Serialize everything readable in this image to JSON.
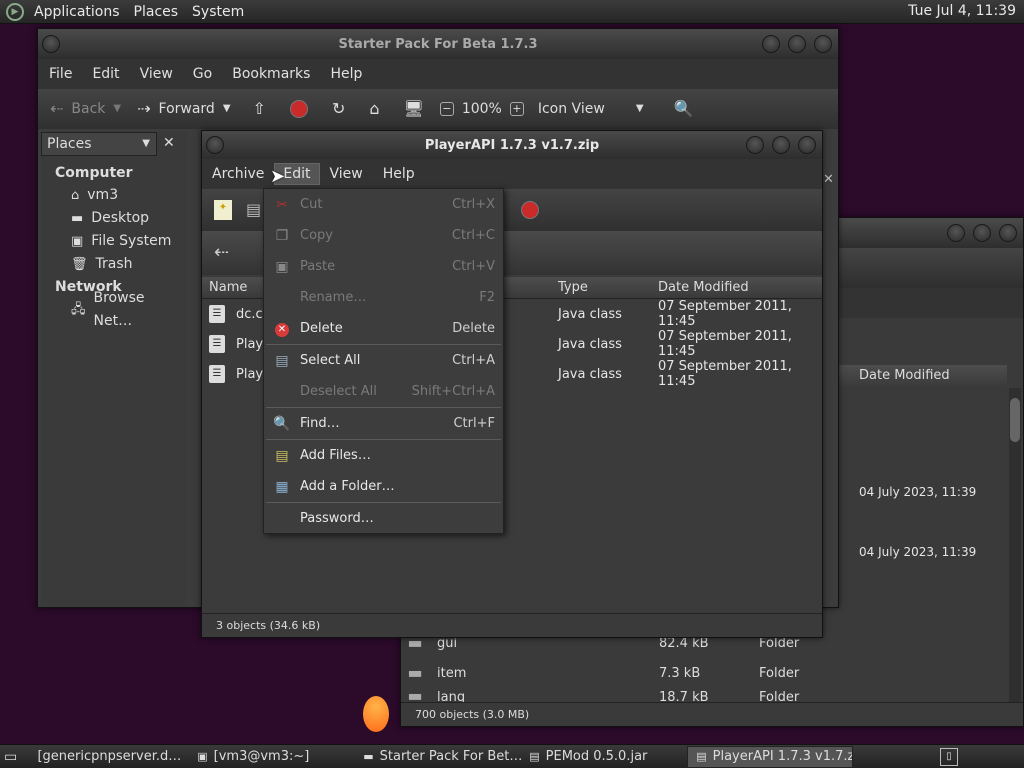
{
  "topbar": {
    "applications": "Applications",
    "places": "Places",
    "system": "System",
    "clock": "Tue Jul  4, 11:39"
  },
  "nautilus": {
    "title": "Starter Pack For Beta 1.7.3",
    "menu": [
      "File",
      "Edit",
      "View",
      "Go",
      "Bookmarks",
      "Help"
    ],
    "toolbar": {
      "back": "Back",
      "forward": "Forward",
      "zoom": "100%",
      "view_mode": "Icon View"
    },
    "sidebar": {
      "selector": "Places",
      "computer_header": "Computer",
      "computer_items": [
        "vm3",
        "Desktop",
        "File System",
        "Trash"
      ],
      "network_header": "Network",
      "network_items": [
        "Browse Net…"
      ]
    }
  },
  "back_window": {
    "column": "Date Modified",
    "dates": [
      "04 July 2023, 11:39",
      "04 July 2023, 11:39"
    ],
    "rows": [
      {
        "name": "gui",
        "size": "82.4 kB",
        "type": "Folder"
      },
      {
        "name": "item",
        "size": "7.3 kB",
        "type": "Folder"
      },
      {
        "name": "lang",
        "size": "18.7 kB",
        "type": "Folder"
      }
    ],
    "status": "700 objects (3.0 MB)"
  },
  "archive": {
    "title": "PlayerAPI 1.7.3 v1.7.zip",
    "menu": [
      "Archive",
      "Edit",
      "View",
      "Help"
    ],
    "columns": {
      "name": "Name",
      "type": "Type",
      "date": "Date Modified"
    },
    "rows": [
      {
        "name": "dc.cla",
        "type": "Java class",
        "date": "07 September 2011, 11:45"
      },
      {
        "name": "Playe",
        "type": "Java class",
        "date": "07 September 2011, 11:45"
      },
      {
        "name": "Playe",
        "type": "Java class",
        "date": "07 September 2011, 11:45"
      }
    ],
    "status": "3 objects (34.6 kB)"
  },
  "edit_menu": {
    "items": [
      {
        "label": "Cut",
        "accel": "Ctrl+X"
      },
      {
        "label": "Copy",
        "accel": "Ctrl+C"
      },
      {
        "label": "Paste",
        "accel": "Ctrl+V"
      },
      {
        "label": "Rename…",
        "accel": "F2"
      },
      {
        "label": "Delete",
        "accel": "Delete"
      },
      {
        "label": "Select All",
        "accel": "Ctrl+A"
      },
      {
        "label": "Deselect All",
        "accel": "Shift+Ctrl+A"
      },
      {
        "label": "Find…",
        "accel": "Ctrl+F"
      },
      {
        "label": "Add Files…",
        "accel": ""
      },
      {
        "label": "Add a Folder…",
        "accel": ""
      },
      {
        "label": "Password…",
        "accel": ""
      }
    ]
  },
  "taskbar": {
    "tasks": [
      "[genericpnpserver.d…",
      "[vm3@vm3:~]",
      "Starter Pack For Bet…",
      "PEMod 0.5.0.jar",
      "PlayerAPI 1.7.3 v1.7.zip"
    ]
  },
  "colors": {
    "desktop": "#2b0a2a",
    "window": "#3c3c3c",
    "delete_icon": "#d93a3a",
    "stop_icon": "#c92a2a",
    "find_icon": "#3a5fd9"
  }
}
